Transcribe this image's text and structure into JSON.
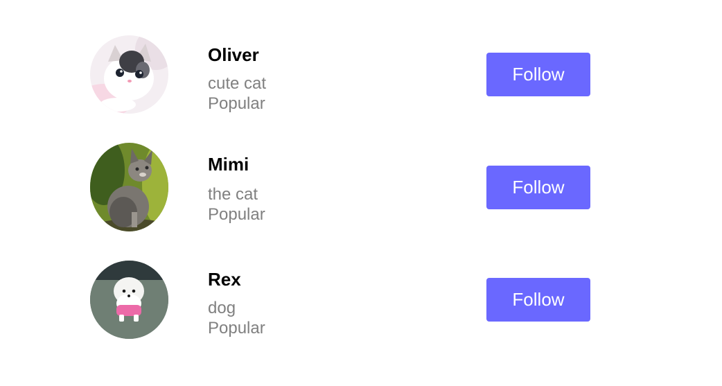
{
  "colors": {
    "accent": "#6a68ff",
    "name_text": "#000000",
    "secondary_text": "#808080",
    "button_text": "#ffffff"
  },
  "users": [
    {
      "name": "Oliver",
      "description": "cute cat",
      "status": "Popular",
      "button_label": "Follow",
      "avatar": "kitten-photo"
    },
    {
      "name": "Mimi",
      "description": "the cat",
      "status": "Popular",
      "button_label": "Follow",
      "avatar": "cat-photo"
    },
    {
      "name": "Rex",
      "description": "dog",
      "status": "Popular",
      "button_label": "Follow",
      "avatar": "puppy-photo"
    }
  ]
}
